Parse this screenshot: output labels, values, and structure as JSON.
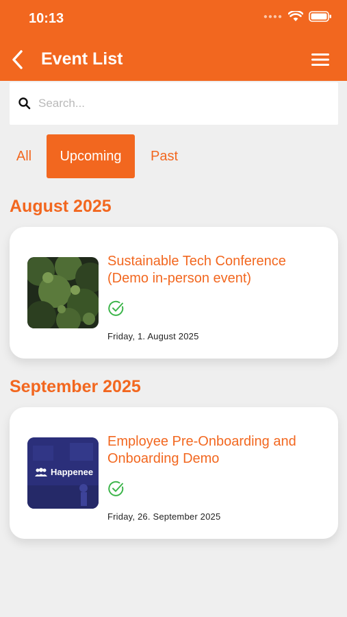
{
  "status_bar": {
    "time": "10:13"
  },
  "nav": {
    "title": "Event List"
  },
  "search": {
    "placeholder": "Search..."
  },
  "filters": [
    {
      "label": "All",
      "active": false
    },
    {
      "label": "Upcoming",
      "active": true
    },
    {
      "label": "Past",
      "active": false
    }
  ],
  "sections": [
    {
      "heading": "August 2025",
      "events": [
        {
          "title": "Sustainable Tech Conference (Demo in-person event)",
          "date": "Friday, 1. August 2025",
          "image": "forest-thumbnail"
        }
      ]
    },
    {
      "heading": "September 2025",
      "events": [
        {
          "title": "Employee Pre-Onboarding and Onboarding Demo",
          "date": "Friday, 26. September 2025",
          "image": "happenee-thumbnail",
          "image_logo_text": "Happenee"
        }
      ]
    }
  ],
  "colors": {
    "accent": "#f2671f",
    "background": "#efefef",
    "check": "#3cb54a"
  }
}
